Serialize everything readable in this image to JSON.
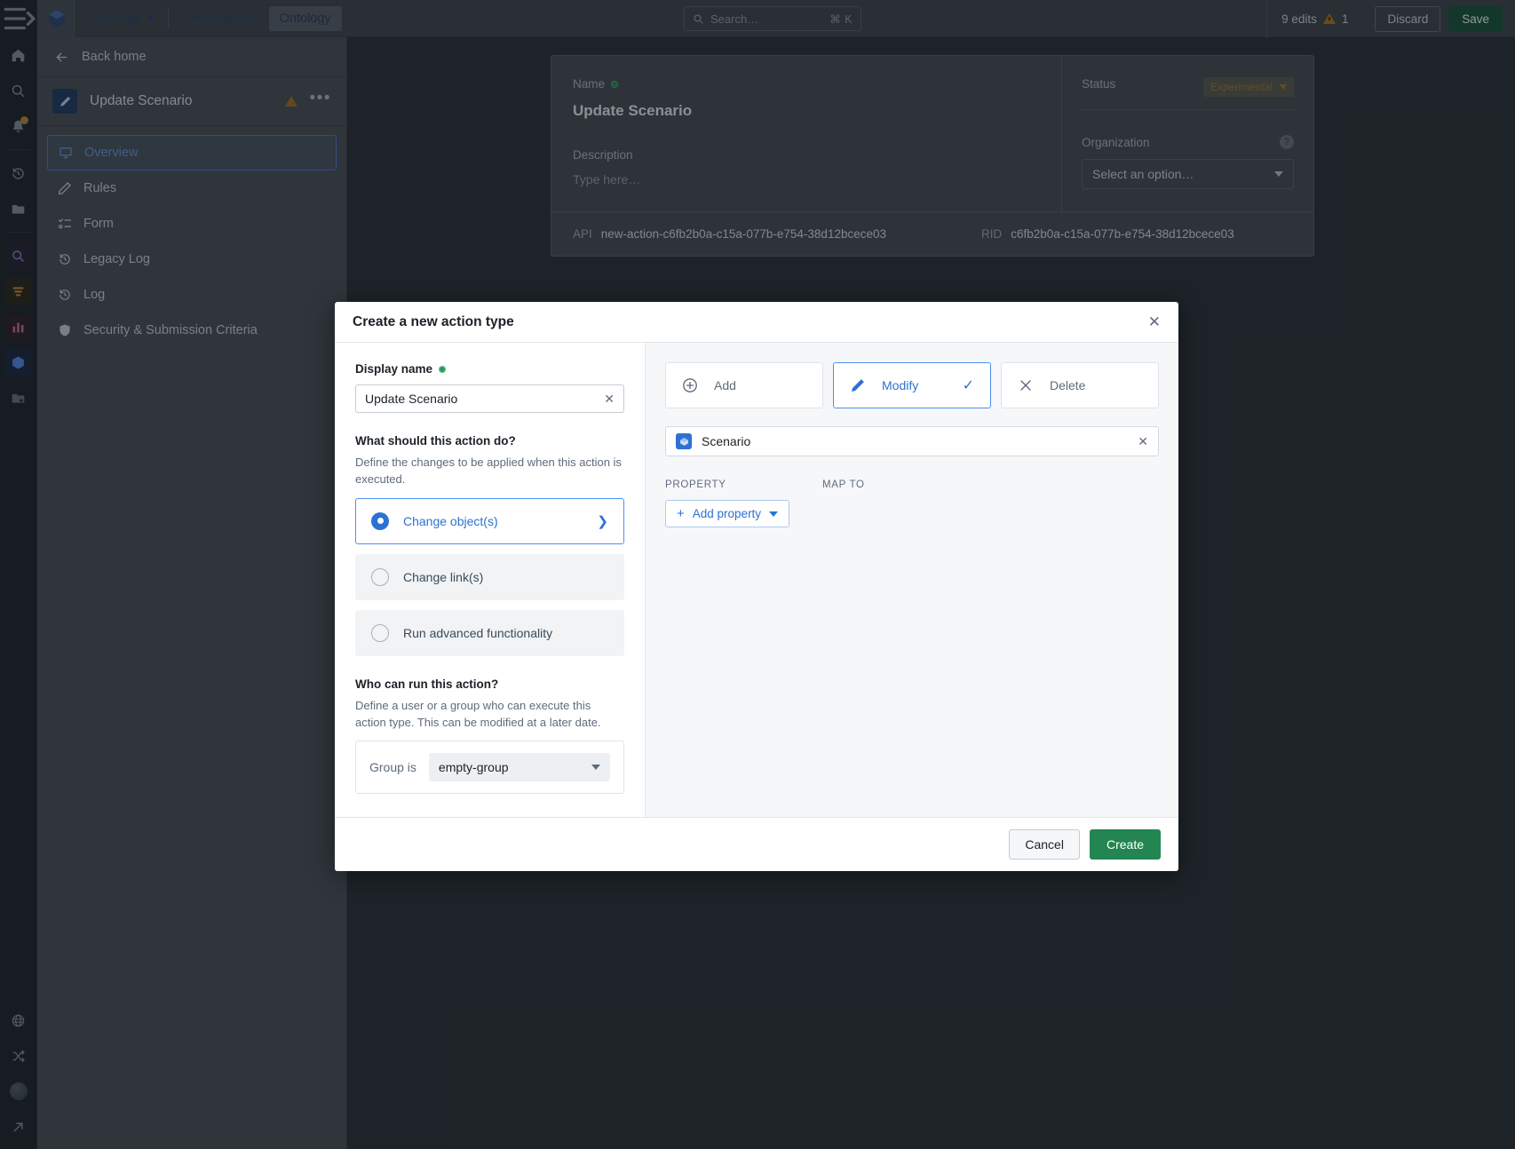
{
  "rail": {
    "items": [
      {
        "name": "home-icon",
        "label": "Home"
      },
      {
        "name": "search-icon",
        "label": "Search"
      },
      {
        "name": "notifications-icon",
        "label": "Notifications"
      },
      {
        "name": "history-icon",
        "label": "History"
      },
      {
        "name": "folder-icon",
        "label": "Projects"
      },
      {
        "name": "app-search-icon",
        "label": "Object Explorer"
      },
      {
        "name": "app-filter-icon",
        "label": "Pipeline"
      },
      {
        "name": "app-chart-icon",
        "label": "Quiver"
      },
      {
        "name": "app-cube-icon",
        "label": "Ontology Manager"
      },
      {
        "name": "app-folder-star-icon",
        "label": "Favorites"
      },
      {
        "name": "globe-icon",
        "label": "Globe"
      },
      {
        "name": "shuffle-icon",
        "label": "Shuffle"
      },
      {
        "name": "user-avatar",
        "label": "Account"
      },
      {
        "name": "expand-icon",
        "label": "Expand"
      }
    ]
  },
  "topbar": {
    "app_menu_label": "Ontology",
    "tabs": [
      {
        "label": "Archetypes",
        "active": false
      },
      {
        "label": "Ontology",
        "active": true
      }
    ],
    "search": {
      "placeholder": "Search…",
      "shortcut": "⌘ K"
    },
    "edits_label": "9 edits",
    "warning_count": "1",
    "discard_label": "Discard",
    "save_label": "Save"
  },
  "sidebar": {
    "back_label": "Back home",
    "entity_title": "Update Scenario",
    "items": [
      {
        "label": "Overview",
        "icon": "monitor-icon",
        "active": true
      },
      {
        "label": "Rules",
        "icon": "pencil-icon",
        "active": false
      },
      {
        "label": "Form",
        "icon": "form-icon",
        "active": false
      },
      {
        "label": "Legacy Log",
        "icon": "history-icon",
        "active": false
      },
      {
        "label": "Log",
        "icon": "history-icon",
        "active": false
      },
      {
        "label": "Security & Submission Criteria",
        "icon": "shield-icon",
        "active": false
      }
    ]
  },
  "main": {
    "name_label": "Name",
    "name_value": "Update Scenario",
    "description_label": "Description",
    "description_placeholder": "Type here…",
    "status_label": "Status",
    "status_value": "Experimental",
    "organization_label": "Organization",
    "organization_value": "Select an option…",
    "api_label": "API",
    "api_value": "new-action-c6fb2b0a-c15a-077b-e754-38d12bcece03",
    "rid_label": "RID",
    "rid_value": "c6fb2b0a-c15a-077b-e754-38d12bcece03"
  },
  "modal": {
    "title": "Create a new action type",
    "display_name_label": "Display name",
    "display_name_value": "Update Scenario",
    "question_label": "What should this action do?",
    "question_sub": "Define the changes to be applied when this action is executed.",
    "options": [
      {
        "label": "Change object(s)",
        "selected": true
      },
      {
        "label": "Change link(s)",
        "selected": false
      },
      {
        "label": "Run advanced functionality",
        "selected": false
      }
    ],
    "who_label": "Who can run this action?",
    "who_sub": "Define a user or a group who can execute this action type. This can be modified at a later date.",
    "group_prefix": "Group is",
    "group_value": "empty-group",
    "segments": [
      {
        "label": "Add",
        "icon": "plus-circle-icon",
        "active": false
      },
      {
        "label": "Modify",
        "icon": "pencil-icon",
        "active": true
      },
      {
        "label": "Delete",
        "icon": "cross-icon",
        "active": false
      }
    ],
    "object_value": "Scenario",
    "col_property": "PROPERTY",
    "col_map_to": "MAP TO",
    "add_property_label": "Add property",
    "cancel_label": "Cancel",
    "create_label": "Create"
  },
  "colors": {
    "accent_blue": "#2d72d2",
    "create_green": "#238551",
    "warning_amber": "#b5761f",
    "status_amber": "#a07b38"
  }
}
